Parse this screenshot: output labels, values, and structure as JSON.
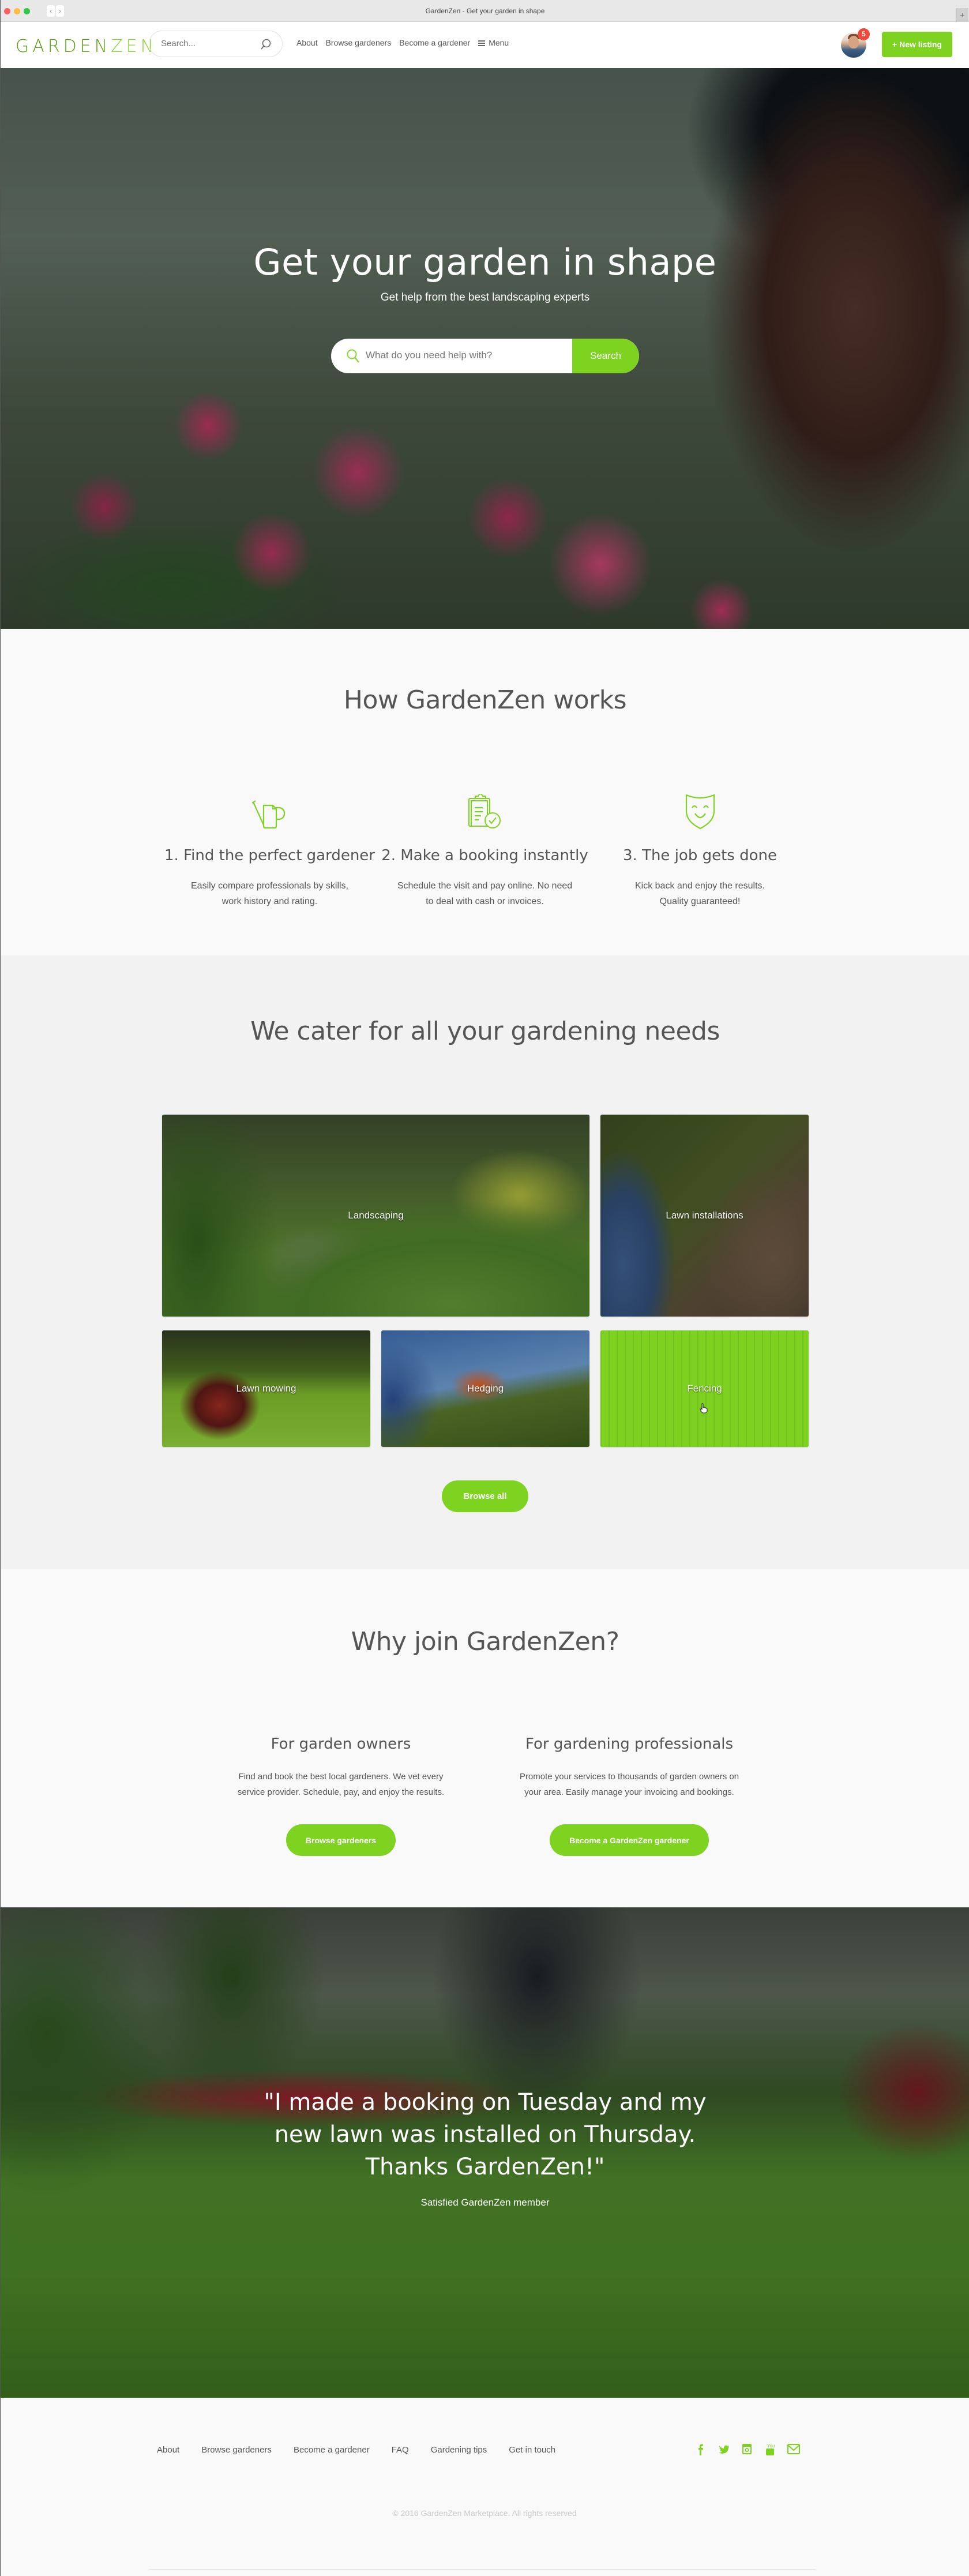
{
  "browser": {
    "title": "GardenZen - Get your garden in shape",
    "back_icon": "chevron-left",
    "forward_icon": "chevron-right",
    "new_tab_icon": "plus"
  },
  "nav": {
    "logo_part1": "GARDEN",
    "logo_part2": "ZEN",
    "search_placeholder": "Search...",
    "links": [
      "About",
      "Browse gardeners",
      "Become a gardener"
    ],
    "menu_label": "Menu",
    "notification_count": "5",
    "new_listing_label": "+ New listing"
  },
  "hero": {
    "title": "Get your garden in shape",
    "subtitle": "Get help from the best landscaping experts",
    "search_placeholder": "What do you need help with?",
    "search_button": "Search"
  },
  "how": {
    "title": "How GardenZen works",
    "steps": [
      {
        "icon": "watering-can",
        "title": "1. Find the perfect gardener",
        "desc_line1": "Easily compare professionals by skills,",
        "desc_line2": "work history and rating."
      },
      {
        "icon": "clipboard-check",
        "title": "2. Make a booking instantly",
        "desc_line1": "Schedule the visit and pay online. No need",
        "desc_line2": "to deal with cash or invoices."
      },
      {
        "icon": "smiling-mask",
        "title": "3. The job gets done",
        "desc_line1": "Kick back and enjoy the results.",
        "desc_line2": "Quality guaranteed!"
      }
    ]
  },
  "cater": {
    "title": "We cater for all your gardening needs",
    "categories": [
      "Landscaping",
      "Lawn installations",
      "Lawn mowing",
      "Hedging",
      "Fencing"
    ],
    "hovered_category": "Fencing",
    "browse_all_label": "Browse all"
  },
  "why": {
    "title": "Why join GardenZen?",
    "columns": [
      {
        "title": "For garden owners",
        "line1": "Find and book the best local gardeners. We vet every",
        "line2": "service provider. Schedule, pay, and enjoy the results.",
        "button": "Browse gardeners"
      },
      {
        "title": "For gardening professionals",
        "line1": "Promote your services to thousands of garden owners on",
        "line2": "your area. Easily manage your invoicing and bookings.",
        "button": "Become a GardenZen gardener"
      }
    ]
  },
  "testimonial": {
    "quote": "\"I made a booking on Tuesday and my new lawn was installed on Thursday. Thanks GardenZen!\"",
    "author": "Satisfied GardenZen member"
  },
  "footer": {
    "links": [
      "About",
      "Browse gardeners",
      "Become a gardener",
      "FAQ",
      "Gardening tips",
      "Get in touch"
    ],
    "socials": [
      "facebook",
      "twitter",
      "instagram",
      "youtube",
      "email"
    ],
    "copyright": "© 2016 GardenZen Marketplace. All rights reserved"
  },
  "colors": {
    "accent": "#7ed321",
    "logo_dark": "#5a9d11",
    "logo_light": "#8bd43a",
    "badge": "#f0493a",
    "text": "#555555"
  }
}
